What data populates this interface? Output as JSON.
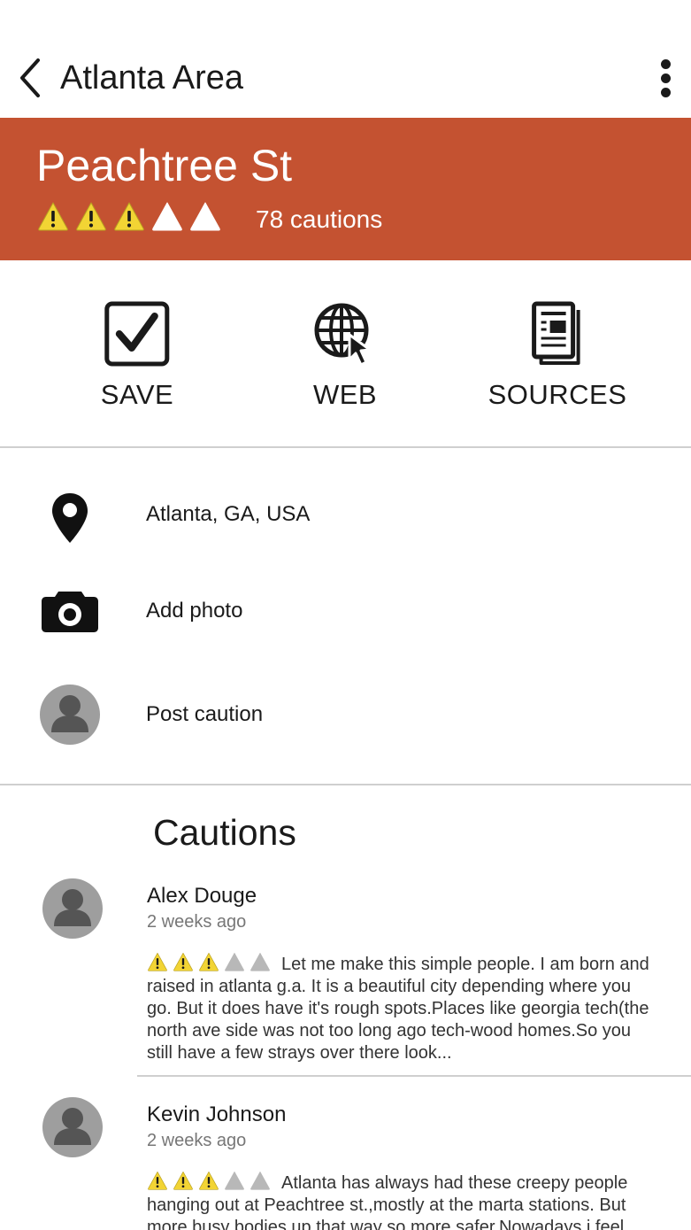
{
  "appbar": {
    "title": "Atlanta Area",
    "back_icon": "chevron-left-icon",
    "menu_icon": "more-vertical-icon"
  },
  "place": {
    "name": "Peachtree St",
    "rating": 3,
    "rating_max": 5,
    "caution_count": "78 cautions",
    "header_color": "#c45231",
    "warning_color": "#f2d434"
  },
  "actions": [
    {
      "label": "SAVE",
      "icon": "checkbox-checked-icon"
    },
    {
      "label": "WEB",
      "icon": "globe-cursor-icon"
    },
    {
      "label": "SOURCES",
      "icon": "documents-icon"
    }
  ],
  "info": {
    "location": {
      "text": "Atlanta, GA, USA",
      "icon": "map-pin-icon"
    },
    "photo": {
      "text": "Add photo",
      "icon": "camera-icon"
    },
    "post": {
      "text": "Post caution",
      "icon": "user-avatar-icon"
    }
  },
  "cautions": {
    "title": "Cautions",
    "items": [
      {
        "author": "Alex Douge",
        "time": "2 weeks ago",
        "rating": 3,
        "text": "Let me make this simple people. I am born and raised in atlanta g.a. It is a beautiful city depending where you go. But it does have it's rough spots.Places like georgia tech(the north ave side was not too long ago tech-wood homes.So you still have a few strays over there look..."
      },
      {
        "author": "Kevin Johnson",
        "time": "2 weeks ago",
        "rating": 3,
        "text": "Atlanta has always had these creepy people hanging out at Peachtree st.,mostly at the marta stations. But more busy bodies up that way so more safer.Nowadays i feel"
      }
    ]
  }
}
